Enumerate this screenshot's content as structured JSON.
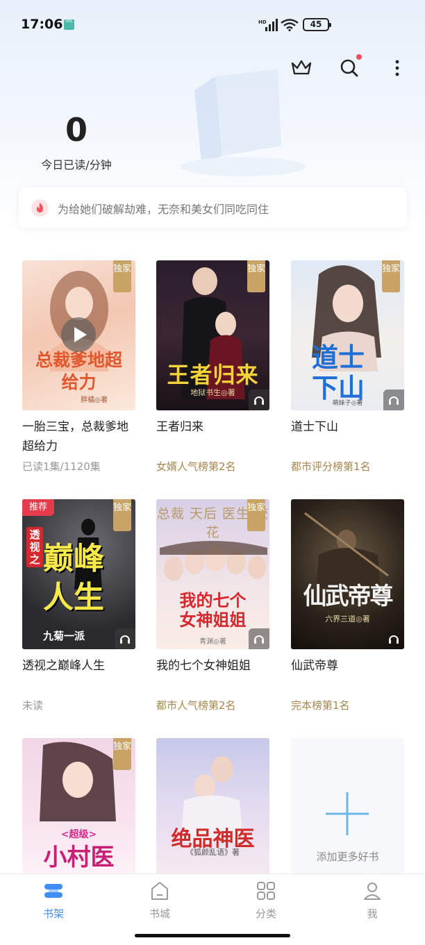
{
  "status_bar": {
    "time": "17:06",
    "network": "HD",
    "battery": "45"
  },
  "toolbar": {
    "icons": [
      "crown-icon",
      "search-icon",
      "more-icon"
    ]
  },
  "reading_stats": {
    "count": "0",
    "label": "今日已读/分钟"
  },
  "notice": {
    "text": "为给她们破解劫难，无奈和美女们同吃同住"
  },
  "books": [
    {
      "name": "一胎三宝，总裁爹地超给力",
      "meta": "已读1集/1120集",
      "cover_title": "总裁爹地超给力",
      "cover_author": "胖橘◎著",
      "exclusive_tag": "独家",
      "recommend_tag": "",
      "has_video": true,
      "has_audio": false
    },
    {
      "name": "王者归来",
      "meta": "女婿人气榜第2名",
      "cover_title": "王者归来",
      "cover_author": "地狱书生◎著",
      "exclusive_tag": "独家",
      "recommend_tag": "",
      "has_video": false,
      "has_audio": true
    },
    {
      "name": "道士下山",
      "meta": "都市评分榜第1名",
      "cover_title": "道士下山",
      "cover_author": "萌妹子◎著",
      "exclusive_tag": "独家",
      "recommend_tag": "",
      "has_video": false,
      "has_audio": true
    },
    {
      "name": "透视之巅峰人生",
      "meta": "未读",
      "cover_title": "巅峰人生",
      "cover_subtitle": "透视之",
      "cover_author": "九菊一派",
      "exclusive_tag": "独家",
      "recommend_tag": "推荐",
      "has_video": false,
      "has_audio": true
    },
    {
      "name": "我的七个女神姐姐",
      "meta": "都市人气榜第2名",
      "cover_title": "我的七个女神姐姐",
      "cover_topline": "总裁 天后 医生 校花",
      "cover_author": "青渊◎著",
      "exclusive_tag": "独家",
      "recommend_tag": "",
      "has_video": false,
      "has_audio": true
    },
    {
      "name": "仙武帝尊",
      "meta": "完本榜第1名",
      "cover_title": "仙武帝尊",
      "cover_author": "六界三道◎著",
      "exclusive_tag": "",
      "recommend_tag": "",
      "has_video": false,
      "has_audio": true
    },
    {
      "name": "",
      "meta": "",
      "cover_title": "小村医",
      "cover_subtitle": "<超级>",
      "exclusive_tag": "独家",
      "recommend_tag": ""
    },
    {
      "name": "",
      "meta": "",
      "cover_title": "绝品神医",
      "cover_author": "《狐颜乱语》著",
      "exclusive_tag": "",
      "recommend_tag": ""
    }
  ],
  "add_more": {
    "label": "添加更多好书"
  },
  "bottom_nav": [
    {
      "label": "书架",
      "icon": "bookshelf-icon",
      "active": true
    },
    {
      "label": "书城",
      "icon": "bookstore-icon",
      "active": false
    },
    {
      "label": "分类",
      "icon": "category-icon",
      "active": false
    },
    {
      "label": "我",
      "icon": "profile-icon",
      "active": false
    }
  ],
  "colors": {
    "accent": "#3f8df5",
    "gold": "#a8864f",
    "exclusive_tag": "#c9a366",
    "recommend_tag": "#e53b4c"
  }
}
